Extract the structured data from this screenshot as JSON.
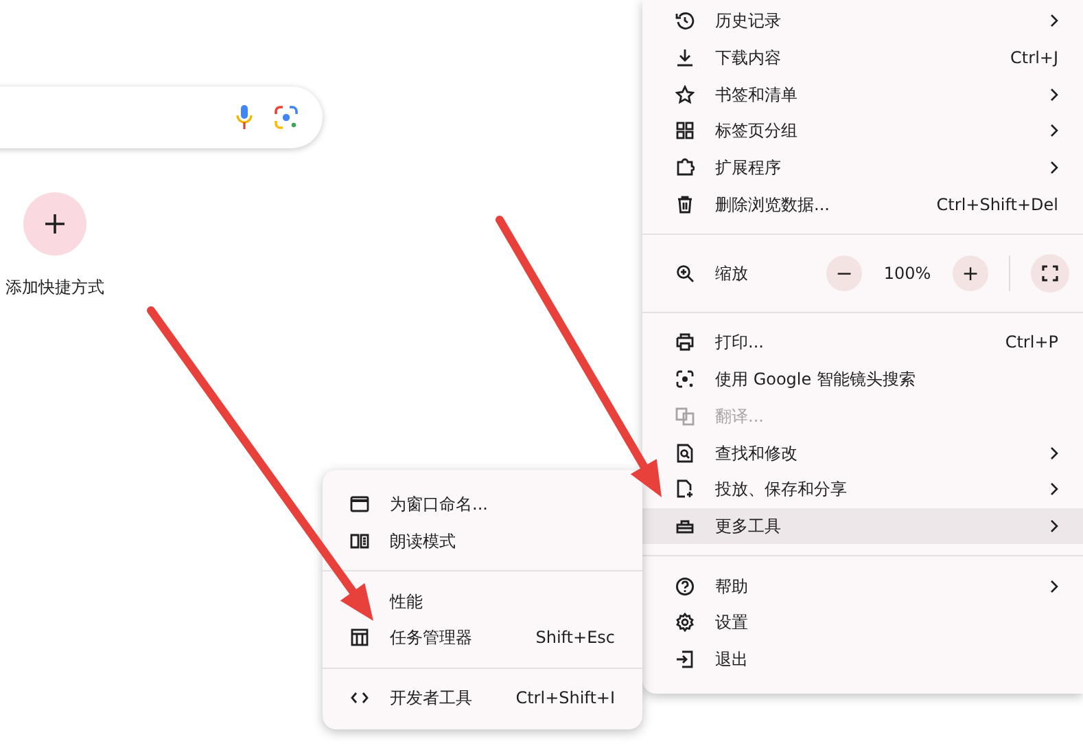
{
  "new_tab": {
    "shortcut": {
      "label": "添加快捷方式"
    }
  },
  "menu": {
    "sections": [
      [
        {
          "kind": "item",
          "label": "历史记录",
          "submenu": true,
          "disabled": false,
          "highlighted": false
        },
        {
          "kind": "item",
          "label": "下载内容",
          "shortcut": "Ctrl+J",
          "submenu": false,
          "disabled": false,
          "highlighted": false
        },
        {
          "kind": "item",
          "label": "书签和清单",
          "submenu": true,
          "disabled": false,
          "highlighted": false
        },
        {
          "kind": "item",
          "label": "标签页分组",
          "submenu": true,
          "disabled": false,
          "highlighted": false
        },
        {
          "kind": "item",
          "label": "扩展程序",
          "submenu": true,
          "disabled": false,
          "highlighted": false
        },
        {
          "kind": "item",
          "label": "删除浏览数据...",
          "shortcut": "Ctrl+Shift+Del",
          "submenu": false,
          "disabled": false,
          "highlighted": false
        }
      ],
      [
        {
          "kind": "zoom",
          "label": "缩放",
          "decrease": "−",
          "value": "100%",
          "increase": "+"
        }
      ],
      [
        {
          "kind": "item",
          "label": "打印...",
          "shortcut": "Ctrl+P",
          "submenu": false,
          "disabled": false,
          "highlighted": false
        },
        {
          "kind": "item",
          "label": "使用 Google 智能镜头搜索",
          "submenu": false,
          "disabled": false,
          "highlighted": false
        },
        {
          "kind": "item",
          "label": "翻译...",
          "submenu": false,
          "disabled": true,
          "highlighted": false
        },
        {
          "kind": "item",
          "label": "查找和修改",
          "submenu": true,
          "disabled": false,
          "highlighted": false
        },
        {
          "kind": "item",
          "label": "投放、保存和分享",
          "submenu": true,
          "disabled": false,
          "highlighted": false
        },
        {
          "kind": "item",
          "label": "更多工具",
          "submenu": true,
          "disabled": false,
          "highlighted": true
        }
      ],
      [
        {
          "kind": "item",
          "label": "帮助",
          "submenu": true,
          "disabled": false,
          "highlighted": false
        },
        {
          "kind": "item",
          "label": "设置",
          "submenu": false,
          "disabled": false,
          "highlighted": false
        },
        {
          "kind": "item",
          "label": "退出",
          "submenu": false,
          "disabled": false,
          "highlighted": false
        }
      ]
    ]
  },
  "submenu": {
    "sections": [
      [
        {
          "kind": "item",
          "label": "为窗口命名...",
          "submenu": false,
          "disabled": false,
          "highlighted": false
        },
        {
          "kind": "item",
          "label": "朗读模式",
          "submenu": false,
          "disabled": false,
          "highlighted": false
        }
      ],
      [
        {
          "kind": "item",
          "label": "性能",
          "submenu": false,
          "disabled": false,
          "highlighted": false
        },
        {
          "kind": "item",
          "label": "任务管理器",
          "shortcut": "Shift+Esc",
          "submenu": false,
          "disabled": false,
          "highlighted": false
        }
      ],
      [
        {
          "kind": "item",
          "label": "开发者工具",
          "shortcut": "Ctrl+Shift+I",
          "submenu": false,
          "disabled": false,
          "highlighted": false
        }
      ]
    ]
  }
}
